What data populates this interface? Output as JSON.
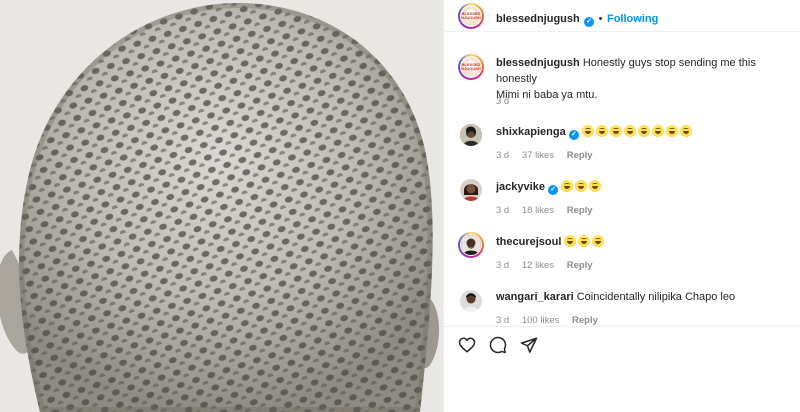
{
  "post": {
    "author": "blessednjugush",
    "separator": "•",
    "follow_state": "Following",
    "avatar_text_top": "BLESSED",
    "avatar_text_bottom": "NJUGUSH",
    "caption_line1": "Honestly guys stop sending me this honestly",
    "caption_line2": "Mimi ni baba ya mtu.",
    "caption_time": "3 d"
  },
  "comments": [
    {
      "user": "shixkapienga",
      "verified": true,
      "emoji_count": 8,
      "time": "3 d",
      "likes": "37 likes",
      "reply": "Reply"
    },
    {
      "user": "jackyvike",
      "verified": true,
      "emoji_count": 3,
      "time": "3 d",
      "likes": "18 likes",
      "reply": "Reply"
    },
    {
      "user": "thecurejsoul",
      "verified": false,
      "emoji_count": 3,
      "time": "3 d",
      "likes": "12 likes",
      "reply": "Reply"
    },
    {
      "user": "wangari_karari",
      "verified": false,
      "text": "Coincidentally nilipika Chapo leo",
      "time": "3 d",
      "likes": "100 likes",
      "reply": "Reply"
    }
  ],
  "actions": {
    "like_icon": "heart-icon",
    "comment_icon": "comment-bubble-icon",
    "share_icon": "send-paper-plane-icon"
  },
  "colors": {
    "accent_blue": "#0095f6",
    "text": "#262626",
    "secondary_text": "#8e8e8e",
    "divider": "#efefef"
  }
}
